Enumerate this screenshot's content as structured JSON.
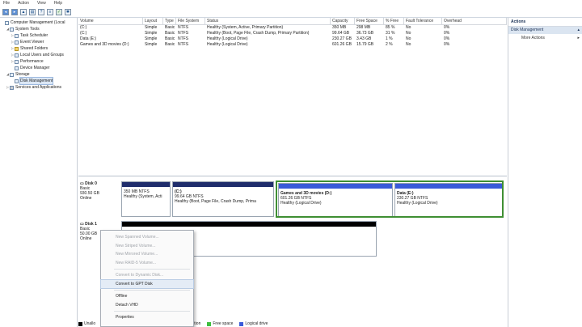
{
  "menu": [
    "File",
    "Action",
    "View",
    "Help"
  ],
  "tree": [
    {
      "label": "Computer Management (Local",
      "indent": 0,
      "icon": "computer-icon",
      "twisty": ""
    },
    {
      "label": "System Tools",
      "indent": 1,
      "icon": "tools-icon",
      "twisty": "◢"
    },
    {
      "label": "Task Scheduler",
      "indent": 2,
      "icon": "clock-icon",
      "twisty": "▷"
    },
    {
      "label": "Event Viewer",
      "indent": 2,
      "icon": "event-viewer-icon",
      "twisty": "▷"
    },
    {
      "label": "Shared Folders",
      "indent": 2,
      "icon": "folder-icon",
      "twisty": "▷"
    },
    {
      "label": "Local Users and Groups",
      "indent": 2,
      "icon": "users-icon",
      "twisty": "▷"
    },
    {
      "label": "Performance",
      "indent": 2,
      "icon": "performance-icon",
      "twisty": "▷"
    },
    {
      "label": "Device Manager",
      "indent": 2,
      "icon": "device-manager-icon",
      "twisty": ""
    },
    {
      "label": "Storage",
      "indent": 1,
      "icon": "storage-icon",
      "twisty": "◢"
    },
    {
      "label": "Disk Management",
      "indent": 2,
      "icon": "disk-management-icon",
      "twisty": "",
      "selected": true
    },
    {
      "label": "Services and Applications",
      "indent": 1,
      "icon": "services-icon",
      "twisty": "▷"
    }
  ],
  "volumes": {
    "headers": [
      "Volume",
      "Layout",
      "Type",
      "File System",
      "Status",
      "Capacity",
      "Free Space",
      "% Free",
      "Fault Tolerance",
      "Overhead"
    ],
    "rows": [
      [
        "(C:)",
        "Simple",
        "Basic",
        "NTFS",
        "Healthy (System, Active, Primary Partition)",
        "350 MB",
        "298 MB",
        "85 %",
        "No",
        "0%"
      ],
      [
        "(C:)",
        "Simple",
        "Basic",
        "NTFS",
        "Healthy (Boot, Page File, Crash Dump, Primary Partition)",
        "99.64 GB",
        "36.73 GB",
        "31 %",
        "No",
        "0%"
      ],
      [
        "Data (E:)",
        "Simple",
        "Basic",
        "NTFS",
        "Healthy (Logical Drive)",
        "230.27 GB",
        "3.43 GB",
        "1 %",
        "No",
        "0%"
      ],
      [
        "Games and 3D movies (D:)",
        "Simple",
        "Basic",
        "NTFS",
        "Healthy (Logical Drive)",
        "601.26 GB",
        "15.79 GB",
        "2 %",
        "No",
        "0%"
      ]
    ]
  },
  "disk0": {
    "name": "Disk 0",
    "type": "Basic",
    "size": "930.50 GB",
    "status": "Online",
    "partitions": [
      {
        "name": "",
        "size": "350 MB NTFS",
        "status": "Healthy (System, Acti"
      },
      {
        "name": "(C:)",
        "size": "99.64 GB NTFS",
        "status": "Healthy (Boot, Page File, Crash Dump, Prima"
      },
      {
        "name": "Games and 3D movies (D:)",
        "size": "601.26 GB NTFS",
        "status": "Healthy (Logical Drive)"
      },
      {
        "name": "Data (E:)",
        "size": "230.27 GB NTFS",
        "status": "Healthy (Logical Drive)"
      }
    ]
  },
  "disk1": {
    "name": "Disk 1",
    "type": "Basic",
    "size": "50.00 GB",
    "status": "Online"
  },
  "context_menu": [
    {
      "label": "New Spanned Volume...",
      "disabled": true
    },
    {
      "label": "New Striped Volume...",
      "disabled": true
    },
    {
      "label": "New Mirrored Volume...",
      "disabled": true
    },
    {
      "label": "New RAID-5 Volume...",
      "disabled": true
    },
    {
      "sep": true
    },
    {
      "label": "Convert to Dynamic Disk...",
      "disabled": true
    },
    {
      "label": "Convert to GPT Disk",
      "disabled": false,
      "highlight": true
    },
    {
      "sep": true
    },
    {
      "label": "Offline",
      "disabled": false
    },
    {
      "label": "Detach VHD",
      "disabled": false
    },
    {
      "sep": true
    },
    {
      "label": "Properties",
      "disabled": false
    }
  ],
  "legend": [
    {
      "label": "Unallo",
      "color": "#000000"
    },
    {
      "label": "ition",
      "color": "#1f2d6c"
    },
    {
      "label": "Free space",
      "color": "#3fbf3f"
    },
    {
      "label": "Logical drive",
      "color": "#3a5bd9"
    }
  ],
  "actions": {
    "title": "Actions",
    "section": "Disk Management",
    "more": "More Actions"
  }
}
